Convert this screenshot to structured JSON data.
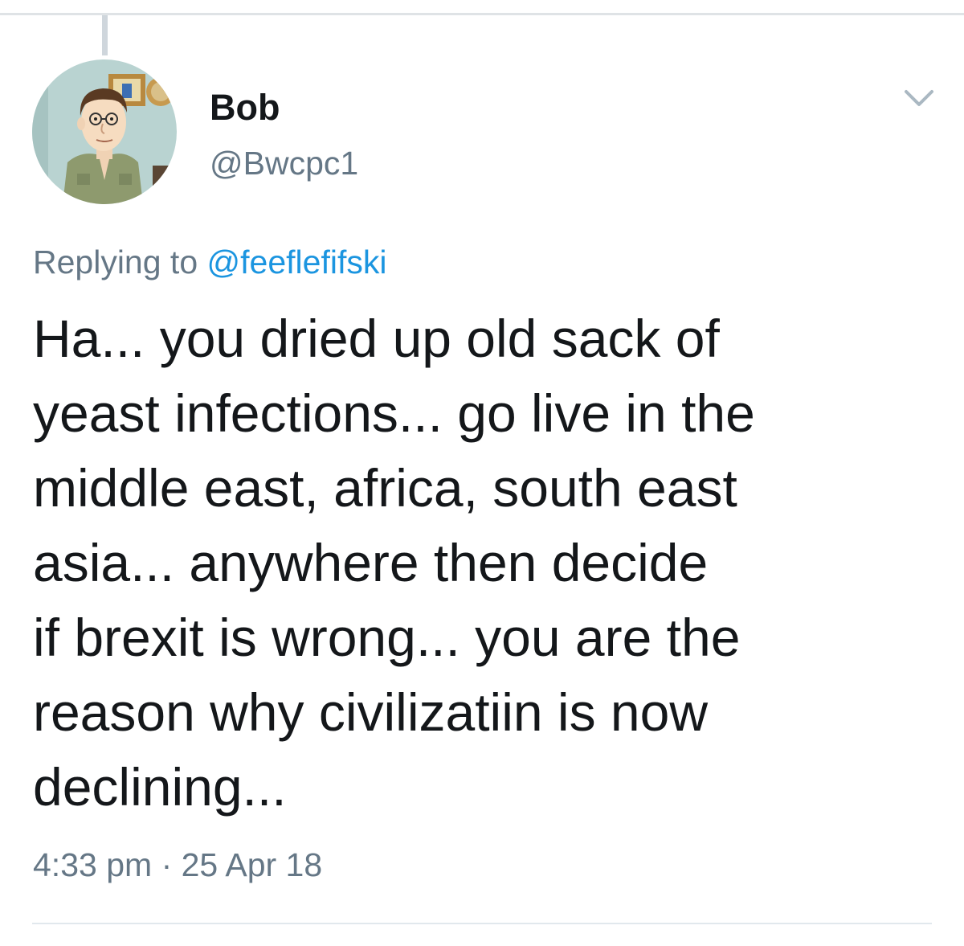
{
  "tweet": {
    "display_name": "Bob",
    "handle": "@Bwcpc1",
    "replying_prefix": "Replying to",
    "replying_to": "@feeflefifski",
    "text": "Ha... you dried up old sack of\nyeast infections... go live in the\nmiddle east, africa, south east\nasia... anywhere then decide\nif brexit is wrong... you are the\nreason why civilizatiin is now\ndeclining...",
    "time": "4:33 pm",
    "separator": "·",
    "date": "25 Apr 18"
  },
  "icons": {
    "menu": "chevron-down-icon",
    "avatar": "cartoon-avatar"
  },
  "colors": {
    "text": "#14171a",
    "secondary": "#657786",
    "link": "#1b95e0",
    "divider": "#e1e8ed"
  }
}
